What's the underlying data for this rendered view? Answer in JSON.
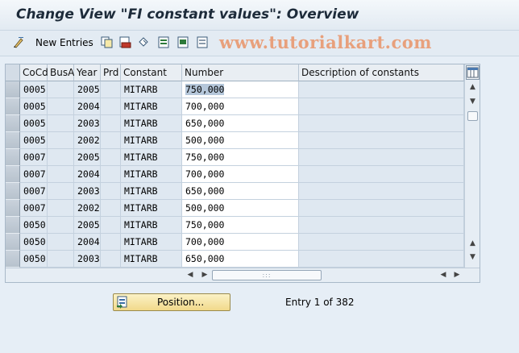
{
  "window": {
    "title": "Change View \"FI constant values\": Overview"
  },
  "toolbar": {
    "new_entries_label": "New Entries",
    "icons": [
      "display-change-icon",
      "copy-icon",
      "delete-icon",
      "undo-icon",
      "select-all-icon",
      "select-block-icon",
      "deselect-all-icon"
    ]
  },
  "watermark": "www.tutorialkart.com",
  "table": {
    "columns": [
      "CoCd",
      "BusA",
      "Year",
      "Prd",
      "Constant",
      "Number",
      "Description of constants"
    ],
    "rows": [
      {
        "cocd": "0005",
        "busa": "",
        "year": "2005",
        "prd": "",
        "constant": "MITARB",
        "number": "750,000",
        "desc": ""
      },
      {
        "cocd": "0005",
        "busa": "",
        "year": "2004",
        "prd": "",
        "constant": "MITARB",
        "number": "700,000",
        "desc": ""
      },
      {
        "cocd": "0005",
        "busa": "",
        "year": "2003",
        "prd": "",
        "constant": "MITARB",
        "number": "650,000",
        "desc": ""
      },
      {
        "cocd": "0005",
        "busa": "",
        "year": "2002",
        "prd": "",
        "constant": "MITARB",
        "number": "500,000",
        "desc": ""
      },
      {
        "cocd": "0007",
        "busa": "",
        "year": "2005",
        "prd": "",
        "constant": "MITARB",
        "number": "750,000",
        "desc": ""
      },
      {
        "cocd": "0007",
        "busa": "",
        "year": "2004",
        "prd": "",
        "constant": "MITARB",
        "number": "700,000",
        "desc": ""
      },
      {
        "cocd": "0007",
        "busa": "",
        "year": "2003",
        "prd": "",
        "constant": "MITARB",
        "number": "650,000",
        "desc": ""
      },
      {
        "cocd": "0007",
        "busa": "",
        "year": "2002",
        "prd": "",
        "constant": "MITARB",
        "number": "500,000",
        "desc": ""
      },
      {
        "cocd": "0050",
        "busa": "",
        "year": "2005",
        "prd": "",
        "constant": "MITARB",
        "number": "750,000",
        "desc": ""
      },
      {
        "cocd": "0050",
        "busa": "",
        "year": "2004",
        "prd": "",
        "constant": "MITARB",
        "number": "700,000",
        "desc": ""
      },
      {
        "cocd": "0050",
        "busa": "",
        "year": "2003",
        "prd": "",
        "constant": "MITARB",
        "number": "650,000",
        "desc": ""
      }
    ]
  },
  "position_button": {
    "label": "Position..."
  },
  "entry_info": "Entry 1 of 382",
  "colors": {
    "background": "#e6eef6",
    "number_cell": "#ffffff",
    "selected_value": "#b5c7da",
    "button": "#f1d98a"
  }
}
